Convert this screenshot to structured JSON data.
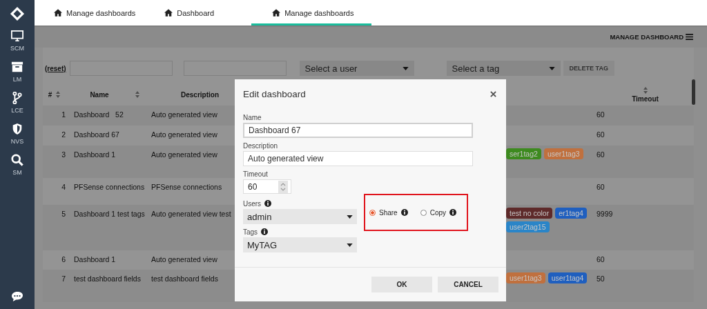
{
  "sidebar": {
    "items": [
      {
        "kind": "monitor",
        "label": "SCM"
      },
      {
        "kind": "archive",
        "label": "LM"
      },
      {
        "kind": "branch",
        "label": "LCE"
      },
      {
        "kind": "shield",
        "label": "NVS"
      },
      {
        "kind": "search",
        "label": "SM"
      }
    ]
  },
  "tabs": [
    {
      "label": "Manage dashboards",
      "selected": false
    },
    {
      "label": "Dashboard",
      "selected": false
    },
    {
      "label": "Manage dashboards",
      "selected": true
    }
  ],
  "toolbar": {
    "title": "MANAGE DASHBOARD"
  },
  "filters": {
    "reset": "(reset)",
    "user_select": {
      "placeholder": "Select a user"
    },
    "tag_select": {
      "placeholder": "Select a tag"
    },
    "delete_tag": {
      "label": "DELETE TAG",
      "disabled": true
    }
  },
  "table": {
    "columns": [
      {
        "label": "#",
        "sortable": true
      },
      {
        "label": "Name",
        "sortable": true
      },
      {
        "label": "Description",
        "sortable": false
      },
      {
        "label": "Timeout",
        "sortable": true
      }
    ],
    "rows": [
      {
        "number": "1",
        "name": "Dashboard   52",
        "description": "Auto generated view",
        "tags": [],
        "timeout": "60"
      },
      {
        "number": "2",
        "name": "Dashboard 67",
        "description": "Auto generated view",
        "tags": [],
        "timeout": "60"
      },
      {
        "number": "3",
        "name": "Dashboard 1",
        "description": "Auto generated view",
        "tags": [
          {
            "label": "ser1tag2",
            "color": "#3d8a1f"
          },
          {
            "label": "user1tag3",
            "color": "#c0703e"
          }
        ],
        "timeout": "60"
      },
      {
        "number": "4",
        "name": "PFSense connections",
        "description": "PFSense connections",
        "tags": [],
        "timeout": "60"
      },
      {
        "number": "5",
        "name": "Dashboard 1 test tags",
        "description": "Auto generated view test",
        "tags": [
          {
            "label": "test no color",
            "color": "#5e2a2a"
          },
          {
            "label": "er1tag4",
            "color": "#1f5fbf"
          },
          {
            "label": "user2tag15",
            "color": "#2a85c8"
          }
        ],
        "timeout": "9999"
      },
      {
        "number": "6",
        "name": "Dashboard 1",
        "description": "Auto generated view",
        "tags": [],
        "timeout": "60"
      },
      {
        "number": "7",
        "name": "test dashboard fields",
        "description": "test dashboard fields",
        "tags": [
          {
            "label": "user1tag3",
            "color": "#c0703e"
          },
          {
            "label": "user1tag4",
            "color": "#1f5fbf"
          }
        ],
        "timeout": "50"
      }
    ]
  },
  "dialog": {
    "title": "Edit dashboard",
    "name": {
      "label": "Name",
      "value": "Dashboard 67"
    },
    "description": {
      "label": "Description",
      "value": "Auto generated view"
    },
    "timeout": {
      "label": "Timeout",
      "value": "60"
    },
    "users": {
      "label": "Users",
      "value": "admin"
    },
    "tags": {
      "label": "Tags",
      "value": "MyTAG"
    },
    "mode_options": [
      {
        "label": "Share",
        "selected": true
      },
      {
        "label": "Copy",
        "selected": false
      }
    ],
    "buttons": [
      "OK",
      "CANCEL"
    ]
  }
}
